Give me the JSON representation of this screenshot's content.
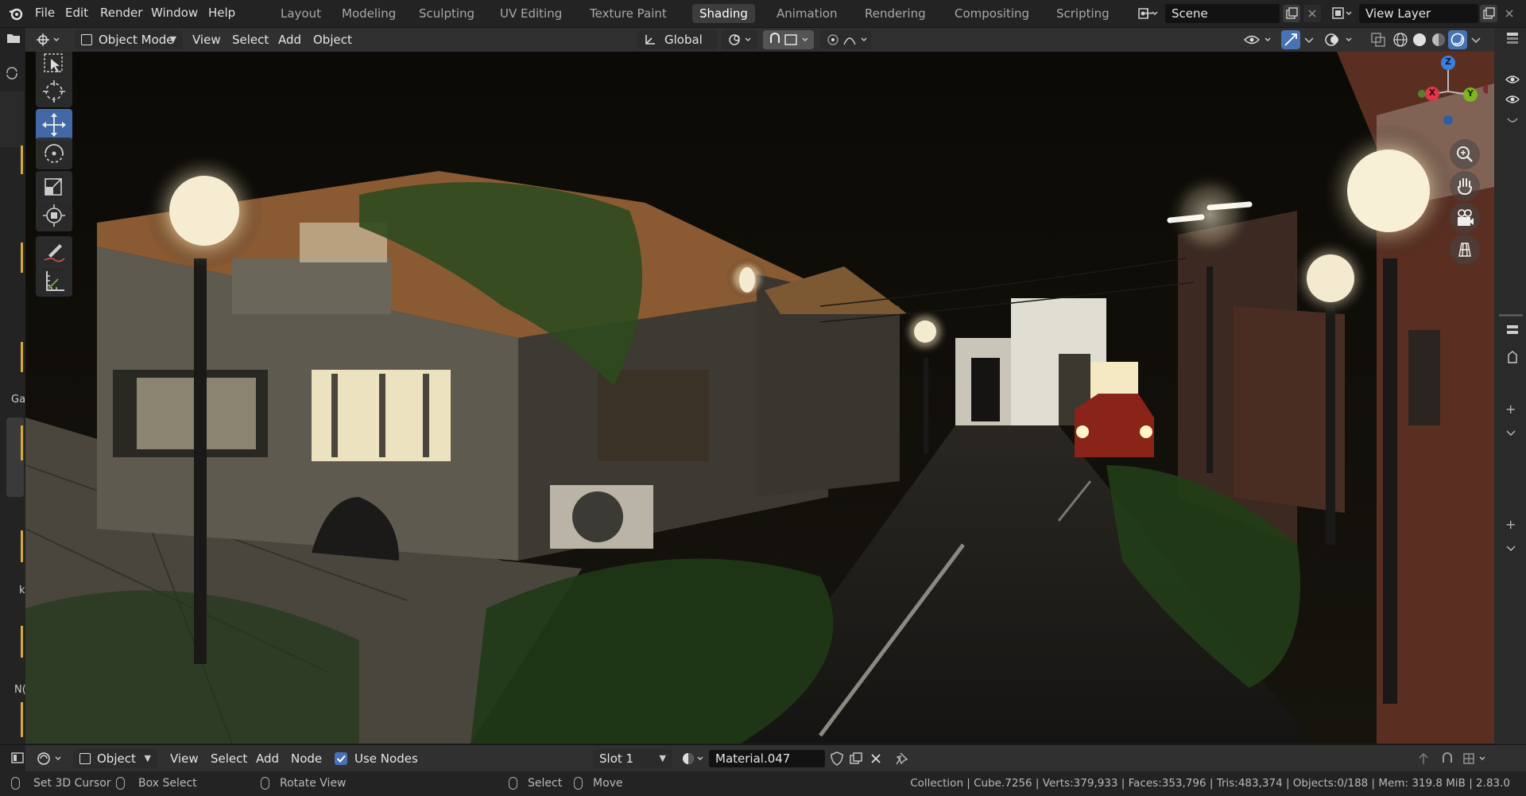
{
  "topbar": {
    "menus": [
      "File",
      "Edit",
      "Render",
      "Window",
      "Help"
    ],
    "workspaces": [
      "Layout",
      "Modeling",
      "Sculpting",
      "UV Editing",
      "Texture Paint",
      "Shading",
      "Animation",
      "Rendering",
      "Compositing",
      "Scripting"
    ],
    "active_workspace": "Shading",
    "scene_name": "Scene",
    "view_layer_name": "View Layer"
  },
  "viewport_header": {
    "mode": "Object Mode",
    "menus": [
      "View",
      "Select",
      "Add",
      "Object"
    ],
    "transform_orientation": "Global"
  },
  "left_panel_fragments": [
    "Ga",
    "k",
    "N("
  ],
  "node_editor_header": {
    "object_type": "Object",
    "menus": [
      "View",
      "Select",
      "Add",
      "Node"
    ],
    "use_nodes_label": "Use Nodes",
    "use_nodes_checked": true,
    "slot": "Slot 1",
    "material": "Material.047"
  },
  "statusbar": {
    "hints": [
      "Set 3D Cursor",
      "Box Select",
      "Rotate View",
      "Select",
      "Move"
    ],
    "stats": "Collection | Cube.7256 | Verts:379,933 | Faces:353,796 | Tris:483,374 | Objects:0/188 | Mem: 319.8 MiB | 2.83.0"
  },
  "gizmo_labels": {
    "x": "X",
    "y": "Y",
    "z": "Z"
  },
  "colors": {
    "accent": "#4772b3",
    "gizmo_x": "#e0384a",
    "gizmo_y": "#7eb51d",
    "gizmo_z": "#3b80e0"
  }
}
